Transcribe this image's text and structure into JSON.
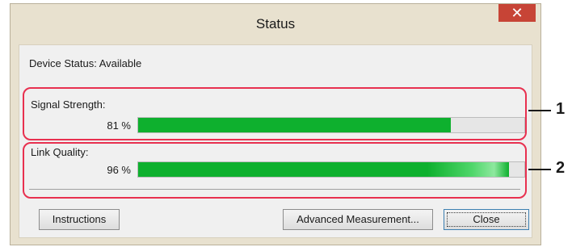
{
  "window": {
    "title": "Status",
    "close_glyph": "✕"
  },
  "device_status": "Device Status: Available",
  "signal": {
    "label": "Signal Strength:",
    "percent_text": "81 %",
    "value_fraction": 0.81,
    "callout": "1"
  },
  "link": {
    "label": "Link Quality:",
    "percent_text": "96 %",
    "value_fraction": 0.96,
    "callout": "2"
  },
  "buttons": {
    "instructions": "Instructions",
    "advanced": "Advanced Measurement...",
    "close": "Close"
  },
  "colors": {
    "bar_fill": "#0eb02e",
    "highlight_border": "#e8304f",
    "close_button_bg": "#c74436"
  }
}
